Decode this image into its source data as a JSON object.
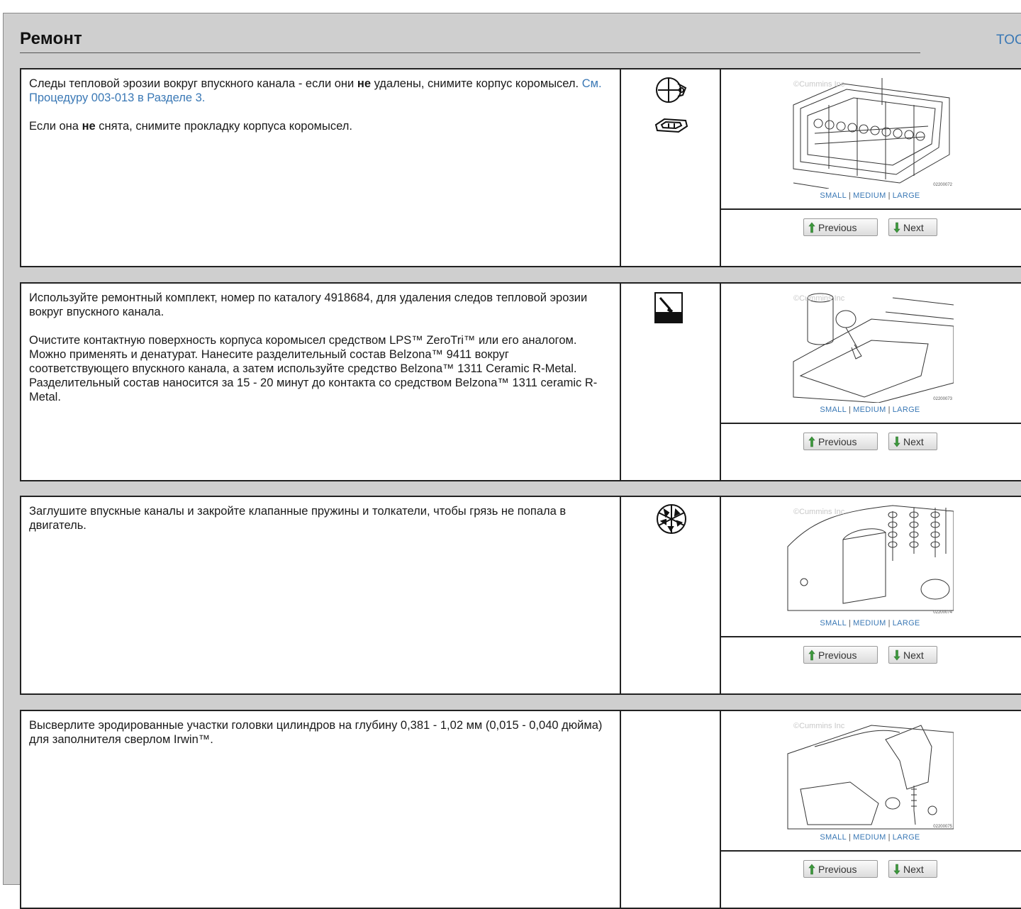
{
  "header": {
    "title": "Ремонт",
    "toc_label": "TOC"
  },
  "steps": [
    {
      "paragraphs": [
        [
          "Следы тепловой эрозии вокруг впускного канала - если они ",
          {
            "b": "не"
          },
          " удалены, снимите корпус коромысел. ",
          {
            "link": "См. Процедуру 003-013 в Разделе 3."
          }
        ],
        [
          "Если она ",
          {
            "b": "не"
          },
          " снята, снимите прокладку корпуса коромысел."
        ]
      ],
      "icons": [
        "wrench-tool-icon",
        "gasket-icon"
      ],
      "figure_id": "02200072",
      "sizes": [
        "SMALL",
        "MEDIUM",
        "LARGE"
      ],
      "prev_label": "Previous",
      "next_label": "Next"
    },
    {
      "paragraphs": [
        [
          "Используйте ремонтный комплект, номер по каталогу 4918684, для удаления следов тепловой эрозии вокруг впускного канала."
        ],
        [
          "Очистите контактную поверхность корпуса коромысел средством LPS™ ZeroTri™ или его аналогом. Можно применять и денатурат. Нанесите разделительный состав Belzona™ 9411 вокруг соответствующего впускного канала, а затем используйте средство Belzona™ 1311 Ceramic R-Metal. Разделительный состав наносится за 15 - 20 минут до контакта со средством Belzona™ 1311 ceramic R-Metal."
        ]
      ],
      "icons": [
        "apply-brush-icon"
      ],
      "figure_id": "02200073",
      "sizes": [
        "SMALL",
        "MEDIUM",
        "LARGE"
      ],
      "prev_label": "Previous",
      "next_label": "Next"
    },
    {
      "paragraphs": [
        [
          "Заглушите впускные каналы и закройте клапанные пружины и толкатели, чтобы грязь не попала в двигатель."
        ]
      ],
      "icons": [
        "cover-openings-icon"
      ],
      "figure_id": "02200074",
      "sizes": [
        "SMALL",
        "MEDIUM",
        "LARGE"
      ],
      "prev_label": "Previous",
      "next_label": "Next"
    },
    {
      "paragraphs": [
        [
          "Высверлите эродированные участки головки цилиндров на глубину 0,381 - 1,02 мм (0,015 - 0,040 дюйма) для заполнителя сверлом Irwin™."
        ]
      ],
      "icons": [],
      "figure_id": "02200075",
      "sizes": [
        "SMALL",
        "MEDIUM",
        "LARGE"
      ],
      "prev_label": "Previous",
      "next_label": "Next"
    }
  ],
  "watermark": "©Cummins Inc",
  "colors": {
    "link": "#3a78b5",
    "frame_bg": "#cfcfcf",
    "up_arrow": "#3c9a3c",
    "down_arrow": "#3c9a3c"
  }
}
